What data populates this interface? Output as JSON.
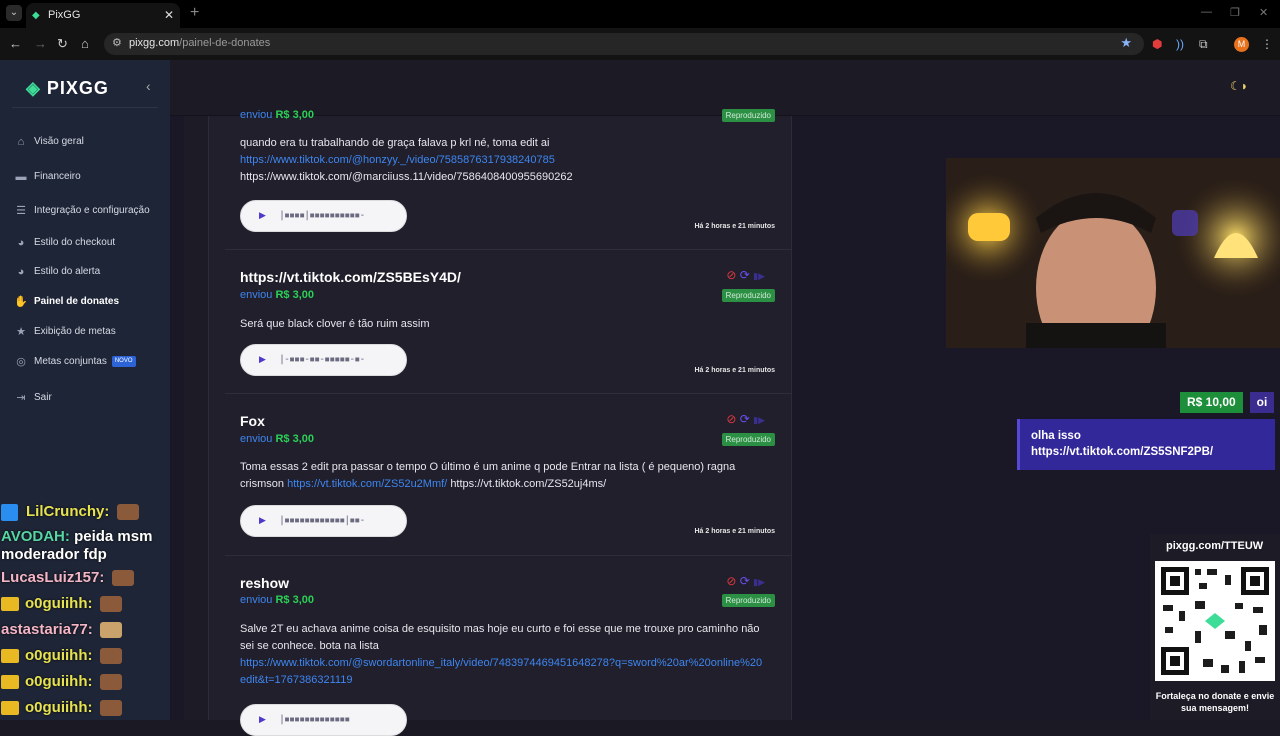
{
  "browser": {
    "tab_title": "PixGG",
    "url_host": "pixgg.com",
    "url_path": "/painel-de-donates",
    "profile_initial": "M"
  },
  "sidebar": {
    "logo": "PIXGG",
    "items": [
      {
        "label": "Visão geral",
        "icon": "home-icon"
      },
      {
        "label": "Financeiro",
        "icon": "wallet-icon"
      },
      {
        "label": "Integração e configuração",
        "icon": "list-icon"
      },
      {
        "label": "Estilo do checkout",
        "icon": "palette-icon"
      },
      {
        "label": "Estilo do alerta",
        "icon": "palette-icon"
      },
      {
        "label": "Painel de donates",
        "icon": "donate-icon"
      },
      {
        "label": "Exibição de metas",
        "icon": "star-icon"
      },
      {
        "label": "Metas conjuntas",
        "icon": "target-icon",
        "badge": "NOVO"
      },
      {
        "label": "Sair",
        "icon": "logout-icon"
      }
    ],
    "active_index": 5
  },
  "chat": [
    {
      "user": "LilCrunchy:",
      "text": "",
      "badge": "twitch"
    },
    {
      "user": "AVODAH:",
      "text": "peida msm"
    },
    {
      "user": "",
      "text": "moderador fdp"
    },
    {
      "user": "LucasLuiz157:",
      "text": ""
    },
    {
      "user": "o0guiihh:",
      "text": "",
      "badge": "crown"
    },
    {
      "user": "astastaria77:",
      "text": ""
    },
    {
      "user": "o0guiihh:",
      "text": "",
      "badge": "crown"
    },
    {
      "user": "o0guiihh:",
      "text": "",
      "badge": "crown"
    },
    {
      "user": "o0guiihh:",
      "text": "",
      "badge": "crown"
    }
  ],
  "donations": [
    {
      "name": "",
      "sent": "enviou",
      "amount": "R$ 3,00",
      "status": "Reproduzido",
      "msg_text": "quando era tu trabalhando de graça falava p krl né, toma edit ai",
      "msg_link": "https://www.tiktok.com/@honzyy._/video/7585876317938240785",
      "msg_tail": "https://www.tiktok.com/@marciiuss.11/video/7586408400955690262",
      "time": "Há 2 horas e 21 minutos"
    },
    {
      "name": "https://vt.tiktok.com/ZS5BEsY4D/",
      "sent": "enviou",
      "amount": "R$ 3,00",
      "status": "Reproduzido",
      "msg_text": "Será que black clover é tão ruim assim",
      "time": "Há 2 horas e 21 minutos"
    },
    {
      "name": "Fox",
      "sent": "enviou",
      "amount": "R$ 3,00",
      "status": "Reproduzido",
      "msg_text": "Toma essas 2 edit pra passar o tempo O último é um anime q pode Entrar na lista ( é pequeno) ragna crismson",
      "msg_link": "https://vt.tiktok.com/ZS52u2Mmf/",
      "msg_tail": "https://vt.tiktok.com/ZS52uj4ms/",
      "time": "Há 2 horas e 21 minutos"
    },
    {
      "name": "reshow",
      "sent": "enviou",
      "amount": "R$ 3,00",
      "status": "Reproduzido",
      "msg_text": "Salve 2T eu achava anime coisa de esquisito mas hoje eu curto e foi esse que me trouxe pro caminho não sei se conhece. bota na lista",
      "msg_link": "https://www.tiktok.com/@swordartonline_italy/video/7483974469451648278?q=sword%20ar%20online%20edit&t=1767386321119"
    }
  ],
  "alert": {
    "amount": "R$ 10,00",
    "name": "oi",
    "message": "olha isso",
    "link": "https://vt.tiktok.com/ZS5SNF2PB/"
  },
  "qr": {
    "url": "pixgg.com/TTEUW",
    "caption": "Fortaleça no donate e envie sua mensagem!"
  },
  "colors": {
    "accent_green": "#2bd156",
    "link_blue": "#3e86f0",
    "sidebar_bg": "#1e2536",
    "alert_purple": "#33289a"
  }
}
